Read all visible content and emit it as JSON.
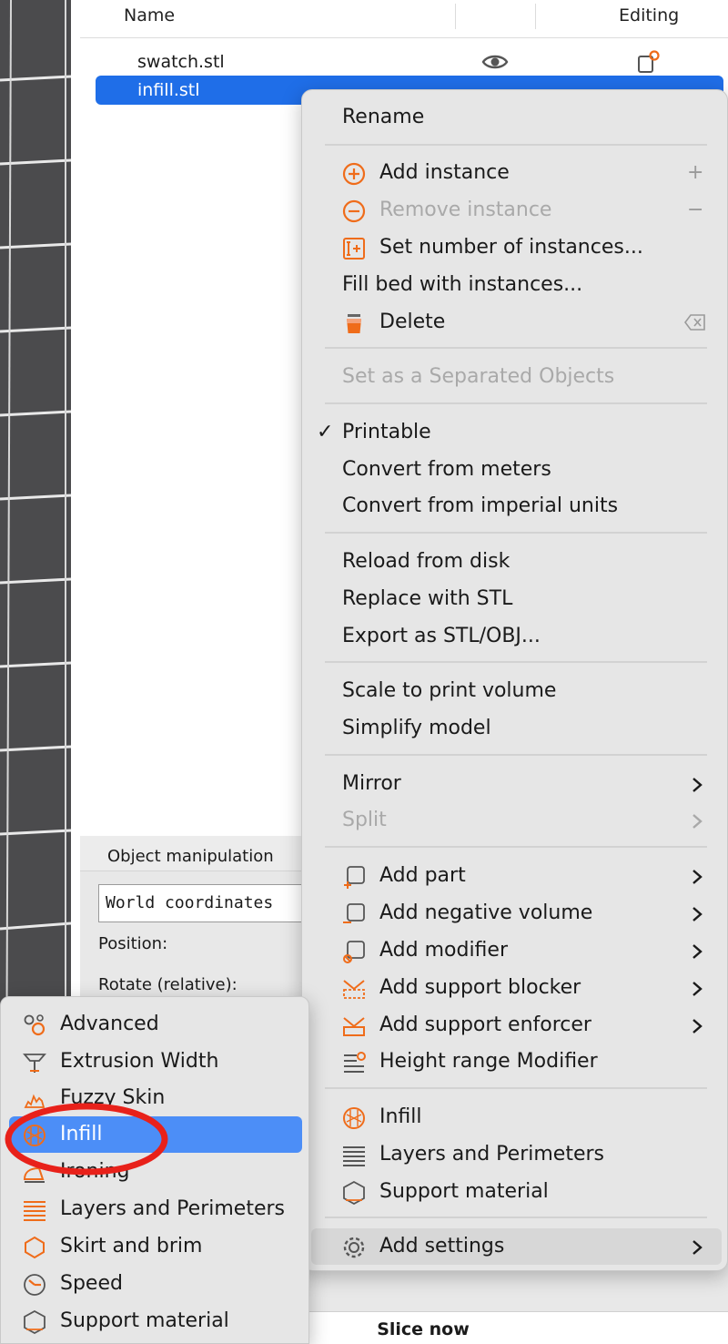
{
  "colors": {
    "accent": "#ef6c1a",
    "selection": "#1f6ee8",
    "submenu_selection": "#4c8ef7",
    "annotation": "#e8211a"
  },
  "object_list": {
    "columns": [
      "Name",
      "Editing"
    ],
    "rows": [
      {
        "name": "swatch.stl",
        "selected": false
      },
      {
        "name": "infill.stl",
        "selected": true
      }
    ]
  },
  "object_manipulation": {
    "title": "Object manipulation",
    "coordinates_select": "World coordinates",
    "position_label": "Position:",
    "rotate_label": "Rotate (relative):"
  },
  "slice_button": "Slice now",
  "context_menu": {
    "items": [
      {
        "label": "Rename"
      },
      {
        "label": "Add instance",
        "icon": "plus-circle-icon",
        "shortcut": "+"
      },
      {
        "label": "Remove instance",
        "icon": "minus-circle-icon",
        "shortcut": "−",
        "disabled": true
      },
      {
        "label": "Set number of instances...",
        "icon": "set-instances-icon"
      },
      {
        "label": "Fill bed with instances..."
      },
      {
        "label": "Delete",
        "icon": "trash-icon",
        "shortcut_icon": "delete-key-icon"
      },
      {
        "label": "Set as a Separated Objects",
        "disabled": true
      },
      {
        "label": "Printable",
        "checked": true
      },
      {
        "label": "Convert from meters"
      },
      {
        "label": "Convert from imperial units"
      },
      {
        "label": "Reload from disk"
      },
      {
        "label": "Replace with STL"
      },
      {
        "label": "Export as STL/OBJ..."
      },
      {
        "label": "Scale to print volume"
      },
      {
        "label": "Simplify model"
      },
      {
        "label": "Mirror",
        "submenu": true
      },
      {
        "label": "Split",
        "submenu": true,
        "disabled": true
      },
      {
        "label": "Add part",
        "icon": "add-part-icon",
        "submenu": true
      },
      {
        "label": "Add negative volume",
        "icon": "negative-volume-icon",
        "submenu": true
      },
      {
        "label": "Add modifier",
        "icon": "modifier-icon",
        "submenu": true
      },
      {
        "label": "Add support blocker",
        "icon": "support-blocker-icon",
        "submenu": true
      },
      {
        "label": "Add support enforcer",
        "icon": "support-enforcer-icon",
        "submenu": true
      },
      {
        "label": "Height range Modifier",
        "icon": "height-range-icon"
      },
      {
        "label": "Infill",
        "icon": "infill-icon"
      },
      {
        "label": "Layers and Perimeters",
        "icon": "layers-icon"
      },
      {
        "label": "Support material",
        "icon": "support-material-icon"
      },
      {
        "label": "Add settings",
        "icon": "gear-icon",
        "submenu": true,
        "highlighted": true
      }
    ]
  },
  "settings_submenu": {
    "items": [
      {
        "label": "Advanced",
        "icon": "advanced-icon"
      },
      {
        "label": "Extrusion Width",
        "icon": "extrusion-width-icon"
      },
      {
        "label": "Fuzzy Skin",
        "icon": "fuzzy-skin-icon"
      },
      {
        "label": "Infill",
        "icon": "infill-icon",
        "selected": true
      },
      {
        "label": "Ironing",
        "icon": "ironing-icon"
      },
      {
        "label": "Layers and Perimeters",
        "icon": "layers-icon"
      },
      {
        "label": "Skirt and brim",
        "icon": "skirt-brim-icon"
      },
      {
        "label": "Speed",
        "icon": "speed-icon"
      },
      {
        "label": "Support material",
        "icon": "support-material-icon"
      }
    ]
  }
}
